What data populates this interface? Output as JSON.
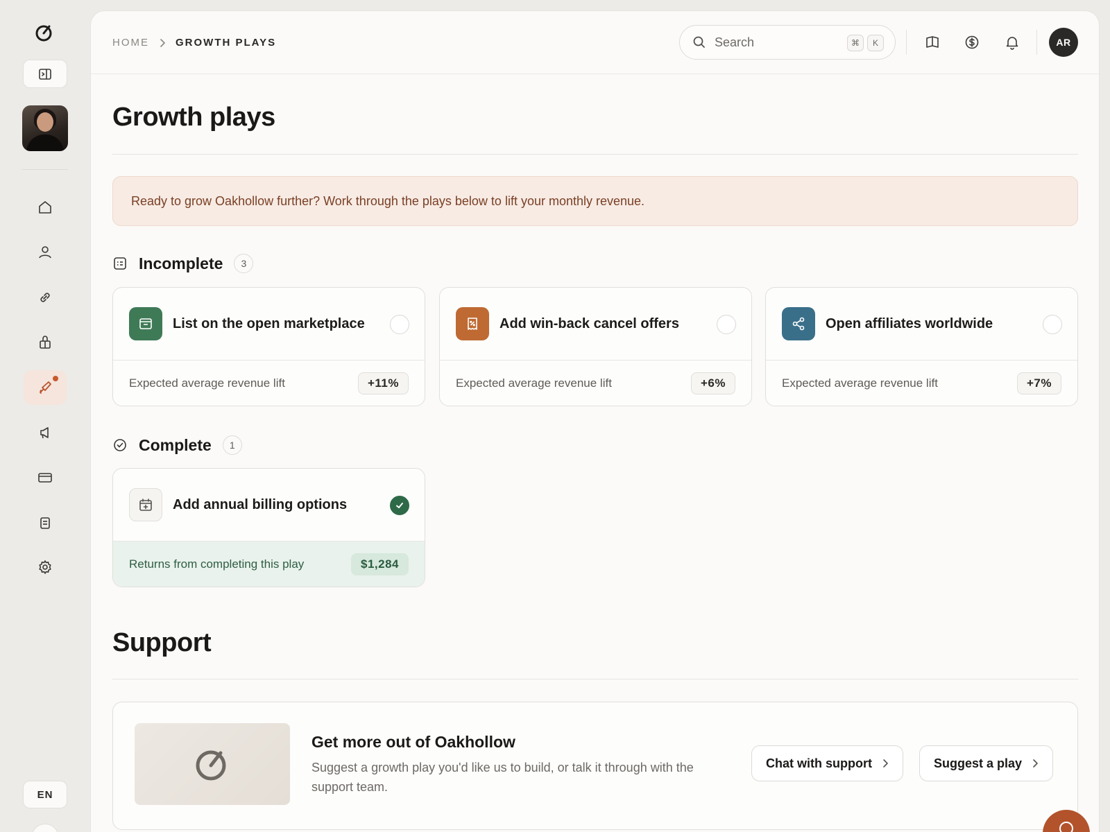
{
  "rail": {
    "logo_icon": "oakhollow-logo-icon",
    "collapse_icon": "sidebar-toggle-icon",
    "nav": [
      {
        "name": "home",
        "icon": "home-icon"
      },
      {
        "name": "customers",
        "icon": "user-icon"
      },
      {
        "name": "links",
        "icon": "link-icon"
      },
      {
        "name": "products",
        "icon": "package-icon"
      },
      {
        "name": "growth",
        "icon": "rocket-icon",
        "active": true
      },
      {
        "name": "marketing",
        "icon": "megaphone-icon"
      },
      {
        "name": "billing",
        "icon": "credit-card-icon"
      },
      {
        "name": "reports",
        "icon": "clipboard-icon"
      },
      {
        "name": "settings",
        "icon": "gear-icon"
      }
    ],
    "language": "EN"
  },
  "header": {
    "breadcrumb": {
      "home": "HOME",
      "current": "GROWTH PLAYS"
    },
    "search": {
      "placeholder": "Search",
      "shortcut_keys": [
        "⌘",
        "K"
      ]
    },
    "icons": [
      "book-icon",
      "dollar-icon",
      "bell-icon"
    ],
    "avatar_initials": "AR"
  },
  "page": {
    "title": "Growth plays",
    "banner": "Ready to grow Oakhollow further? Work through the plays below to lift your monthly revenue."
  },
  "incomplete": {
    "label": "Incomplete",
    "count": "3",
    "cards": [
      {
        "title": "List on the open marketplace",
        "metric_label": "Expected average revenue lift",
        "metric": "+11%",
        "icon": "storefront-icon",
        "color": "#3f7a56"
      },
      {
        "title": "Add win-back cancel offers",
        "metric_label": "Expected average revenue lift",
        "metric": "+6%",
        "icon": "receipt-icon",
        "color": "#bf6a33"
      },
      {
        "title": "Open affiliates worldwide",
        "metric_label": "Expected average revenue lift",
        "metric": "+7%",
        "icon": "share-icon",
        "color": "#3a6f8a"
      }
    ]
  },
  "complete": {
    "label": "Complete",
    "count": "1",
    "cards": [
      {
        "title": "Add annual billing options",
        "metric_label": "Returns from completing this play",
        "metric": "$1,284",
        "icon": "calendar-icon"
      }
    ]
  },
  "support": {
    "title": "Support",
    "heading": "Get more out of Oakhollow",
    "description": "Suggest a growth play you'd like us to build, or talk it through with the support team.",
    "buttons": {
      "chat": "Chat with support",
      "suggest": "Suggest a play"
    }
  },
  "colors": {
    "accent": "#c85a2e",
    "success": "#2e6a48",
    "banner_bg": "#f7ebe4"
  }
}
